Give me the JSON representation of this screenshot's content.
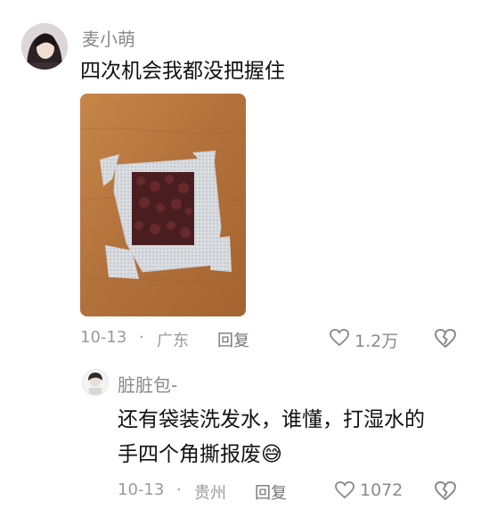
{
  "comment": {
    "username": "麦小萌",
    "text": "四次机会我都没把握住",
    "date": "10-13",
    "separator": "·",
    "location": "广东",
    "reply_label": "回复",
    "likes": "1.2万"
  },
  "reply": {
    "username": "脏脏包-",
    "text_line1": "还有袋装洗发水，谁懂，打湿水的",
    "text_line2": "手四个角撕报废",
    "emoji": "😅",
    "date": "10-13",
    "separator": "·",
    "location": "贵州",
    "reply_label": "回复",
    "likes": "1072"
  },
  "icons": {
    "like": "heart-icon",
    "dislike": "broken-heart-icon"
  }
}
